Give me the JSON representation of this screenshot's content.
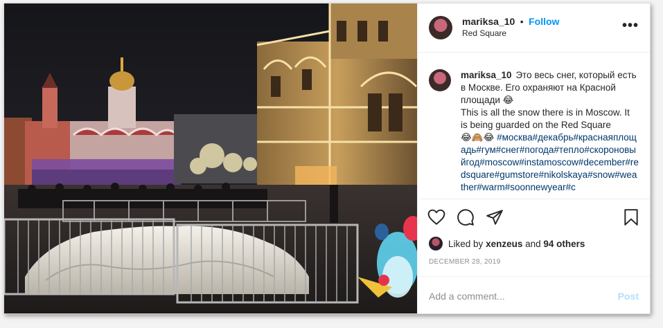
{
  "header": {
    "username": "mariksa_10",
    "separator": "•",
    "follow_label": "Follow",
    "location": "Red Square",
    "more_icon": "more-options-icon"
  },
  "caption": {
    "username": "mariksa_10",
    "text": "Это весь снег, который есть в Москве. Его охраняют на Красной площади 😂\nThis is all the snow there is in Moscow. It is being guarded on the Red Square\n😂🙈😂",
    "hashtags": "#москва#декабрь#краснаяплощадь#гум#снег#погода#тепло#скороновыйгод#moscow#instamoscow#december#redsquare#gumstore#nikolskaya#snow#weather#warm#soonnewyear#c"
  },
  "actions": {
    "icons": [
      "heart-icon",
      "comment-icon",
      "share-icon",
      "bookmark-icon"
    ]
  },
  "likes": {
    "prefix": "Liked by",
    "user": "xenzeus",
    "middle": "and",
    "others": "94 others"
  },
  "date": "DECEMBER 28, 2019",
  "comment_box": {
    "placeholder": "Add a comment...",
    "post_label": "Post"
  },
  "colors": {
    "link_blue": "#0095f6",
    "post_disabled": "#b2dffc",
    "hashtag": "#00376b",
    "muted": "#8e8e8e"
  }
}
